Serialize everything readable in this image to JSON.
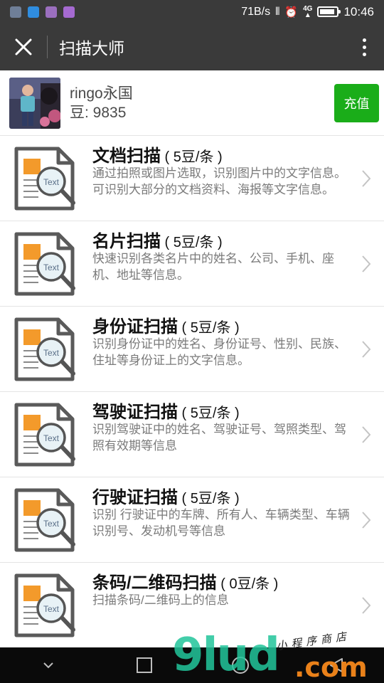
{
  "status_bar": {
    "net_speed": "71B/s",
    "network": "4G",
    "time": "10:46",
    "battery_percent": 90
  },
  "header": {
    "title": "扫描大师"
  },
  "account": {
    "username": "ringo永国",
    "beans": "豆: 9835",
    "recharge_label": "充值"
  },
  "services": [
    {
      "title": "文档扫描",
      "price": " ( 5豆/条 )",
      "desc": "通过拍照或图片选取，识别图片中的文字信息。可识别大部分的文档资料、海报等文字信息。",
      "icon": "document-scan-icon",
      "icon_text": "Text"
    },
    {
      "title": "名片扫描",
      "price": " ( 5豆/条 )",
      "desc": "快速识别各类名片中的姓名、公司、手机、座机、地址等信息。",
      "icon": "document-scan-icon",
      "icon_text": "Text"
    },
    {
      "title": "身份证扫描",
      "price": " ( 5豆/条 )",
      "desc": "识别身份证中的姓名、身份证号、性别、民族、住址等身份证上的文字信息。",
      "icon": "document-scan-icon",
      "icon_text": "Text"
    },
    {
      "title": "驾驶证扫描",
      "price": " ( 5豆/条 )",
      "desc": "识别驾驶证中的姓名、驾驶证号、驾照类型、驾照有效期等信息",
      "icon": "document-scan-icon",
      "icon_text": "Text"
    },
    {
      "title": "行驶证扫描",
      "price": " ( 5豆/条 )",
      "desc": "识别 行驶证中的车牌、所有人、车辆类型、车辆识别号、发动机号等信息",
      "icon": "document-scan-icon",
      "icon_text": "Text"
    },
    {
      "title": "条码/二维码扫描",
      "price": " ( 0豆/条 )",
      "desc": "扫描条码/二维码上的信息",
      "icon": "document-scan-icon",
      "icon_text": "Text"
    }
  ],
  "watermark": {
    "logo": "9lud",
    "domain": ".com",
    "tagline": "小程序商店"
  },
  "colors": {
    "bar_bg": "#3a3a3a",
    "recharge_green": "#1aad19",
    "icon_orange": "#f39a2b",
    "nav_bg": "#0a0a0a"
  }
}
